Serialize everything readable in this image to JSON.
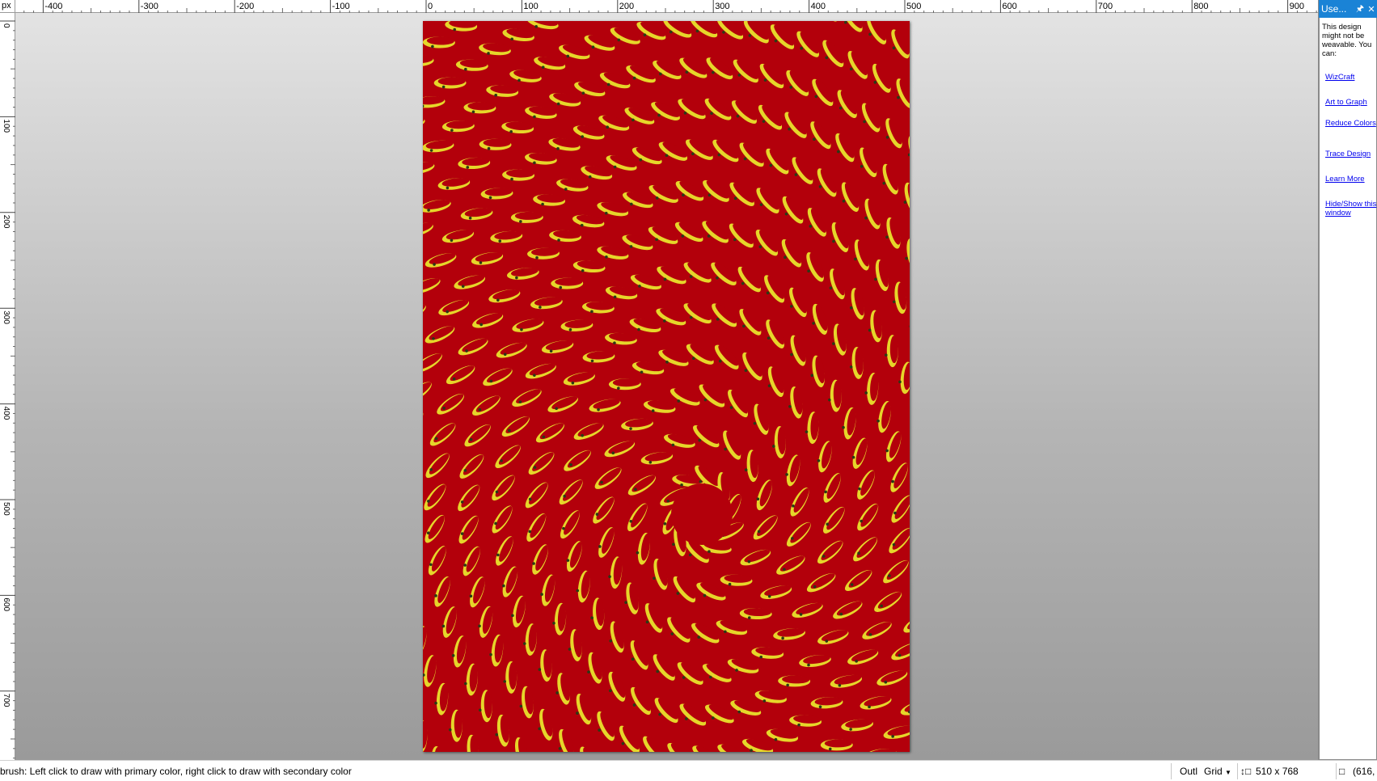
{
  "ruler": {
    "unit": "px",
    "h_labels": [
      "-400",
      "-300",
      "-200",
      "-100",
      "0",
      "100",
      "200",
      "300",
      "400",
      "500",
      "600",
      "700",
      "800",
      "900"
    ],
    "v_labels": [
      "0",
      "100",
      "200",
      "300",
      "400",
      "500",
      "600",
      "700"
    ]
  },
  "panel": {
    "title": "Use...",
    "pin_icon": "pin-icon",
    "close_icon": "close-icon",
    "message": "This design might not be weavable. You can:",
    "links": [
      {
        "label": "WizCraft"
      },
      {
        "label": "Art to Graph"
      },
      {
        "label": "Reduce Colors"
      },
      {
        "label": "Trace Design"
      },
      {
        "label": "Learn More"
      },
      {
        "label": "Hide/Show this window"
      }
    ]
  },
  "canvas": {
    "description_icon": "rope-swirl-image",
    "colors": {
      "red": "#b3000b",
      "yellow": "#e6d62a",
      "dark": "#2a3a16"
    }
  },
  "status": {
    "hint": "brush: Left click to draw with primary color, right click to draw with secondary color",
    "outline": "Outl",
    "grid": "Grid",
    "size": "510 x 768",
    "coords": "(616,"
  }
}
